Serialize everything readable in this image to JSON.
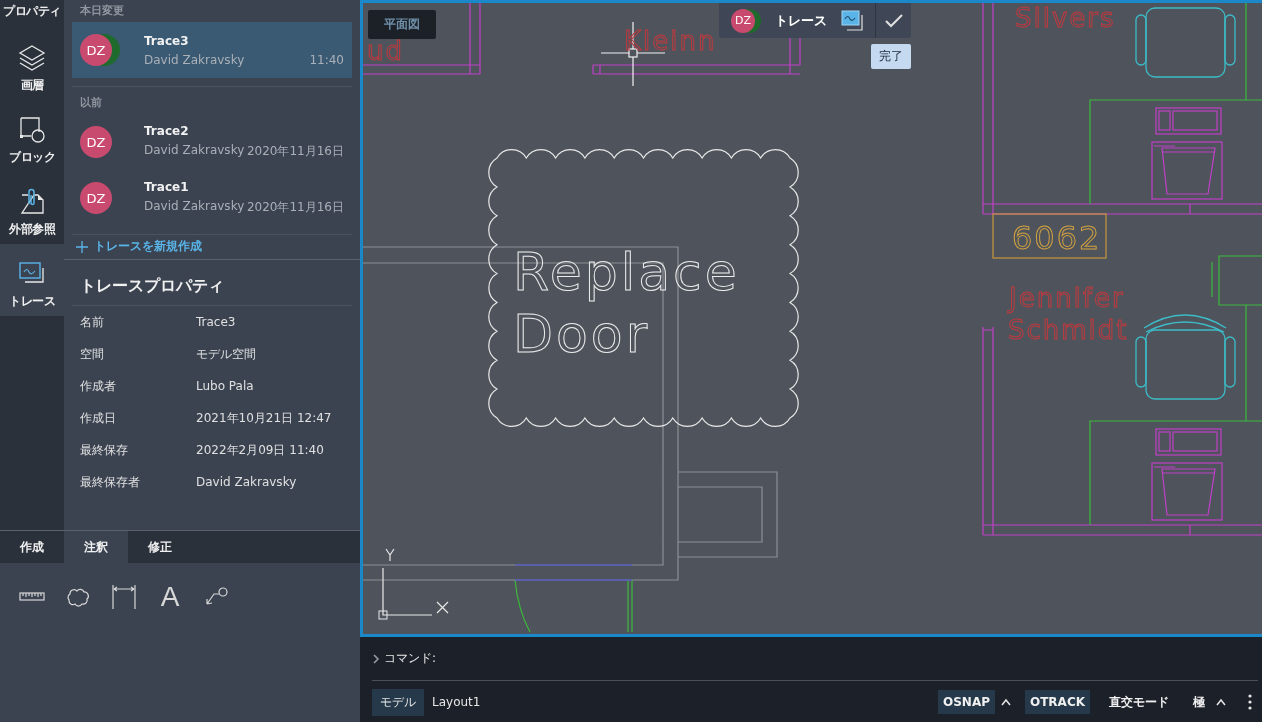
{
  "rail": {
    "items": [
      {
        "label": "プロパティ",
        "kind": "properties",
        "selected": false
      },
      {
        "label": "画層",
        "kind": "layers",
        "selected": false
      },
      {
        "label": "ブロック",
        "kind": "block",
        "selected": false
      },
      {
        "label": "外部参照",
        "kind": "xref",
        "selected": false
      },
      {
        "label": "トレース",
        "kind": "trace",
        "selected": true
      }
    ]
  },
  "trace_list": {
    "groups": [
      {
        "title": "本日変更",
        "items": [
          {
            "name": "Trace3",
            "author": "David Zakravsky",
            "time": "11:40",
            "avatar": "DZ",
            "shared": true,
            "selected": true
          }
        ]
      },
      {
        "title": "以前",
        "items": [
          {
            "name": "Trace2",
            "author": "David Zakravsky",
            "time": "2020年11月16日",
            "avatar": "DZ",
            "shared": false,
            "selected": false
          },
          {
            "name": "Trace1",
            "author": "David Zakravsky",
            "time": "2020年11月16日",
            "avatar": "DZ",
            "shared": false,
            "selected": false
          }
        ]
      }
    ]
  },
  "new_trace": "トレースを新規作成",
  "properties": {
    "title": "トレースプロパティ",
    "rows": [
      {
        "label": "名前",
        "value": "Trace3"
      },
      {
        "label": "空間",
        "value": "モデル空間"
      },
      {
        "label": "作成者",
        "value": "Lubo Pala"
      },
      {
        "label": "作成日",
        "value": "2021年10月21日 12:47"
      },
      {
        "label": "最終保存",
        "value": "2022年2月09日 11:40"
      },
      {
        "label": "最終保存者",
        "value": "David Zakravsky"
      }
    ]
  },
  "tool_tabs": [
    {
      "label": "作成",
      "selected": false
    },
    {
      "label": "注釈",
      "selected": true
    },
    {
      "label": "修正",
      "selected": false
    }
  ],
  "tools": [
    {
      "kind": "measure"
    },
    {
      "kind": "cloud"
    },
    {
      "kind": "dimension"
    },
    {
      "kind": "text",
      "label": "A"
    },
    {
      "kind": "leader"
    }
  ],
  "canvas": {
    "view_label": "平面図",
    "labels": [
      {
        "text": "ud",
        "kind": "name"
      },
      {
        "text": "Kleinn",
        "kind": "name"
      },
      {
        "text": "Silvers",
        "kind": "name"
      },
      {
        "text": "6062",
        "kind": "room"
      },
      {
        "text": "Jennifer",
        "kind": "name"
      },
      {
        "text": "Schmidt",
        "kind": "name"
      },
      {
        "text": "Replace",
        "kind": "note"
      },
      {
        "text": "Door",
        "kind": "note"
      }
    ]
  },
  "trace_toolbar": {
    "avatar": "DZ",
    "shared": true,
    "title": "トレース",
    "tooltip": "完了"
  },
  "command": {
    "prompt": "コマンド:"
  },
  "status_bar": {
    "layouts": [
      {
        "label": "モデル",
        "selected": true
      },
      {
        "label": "Layout1",
        "selected": false
      }
    ],
    "toggles": [
      {
        "label": "OSNAP",
        "on": true,
        "menu": true
      },
      {
        "label": "OTRACK",
        "on": true,
        "menu": false
      },
      {
        "label": "直交モード",
        "on": false,
        "menu": false
      },
      {
        "label": "極",
        "on": false,
        "menu": true
      }
    ]
  }
}
